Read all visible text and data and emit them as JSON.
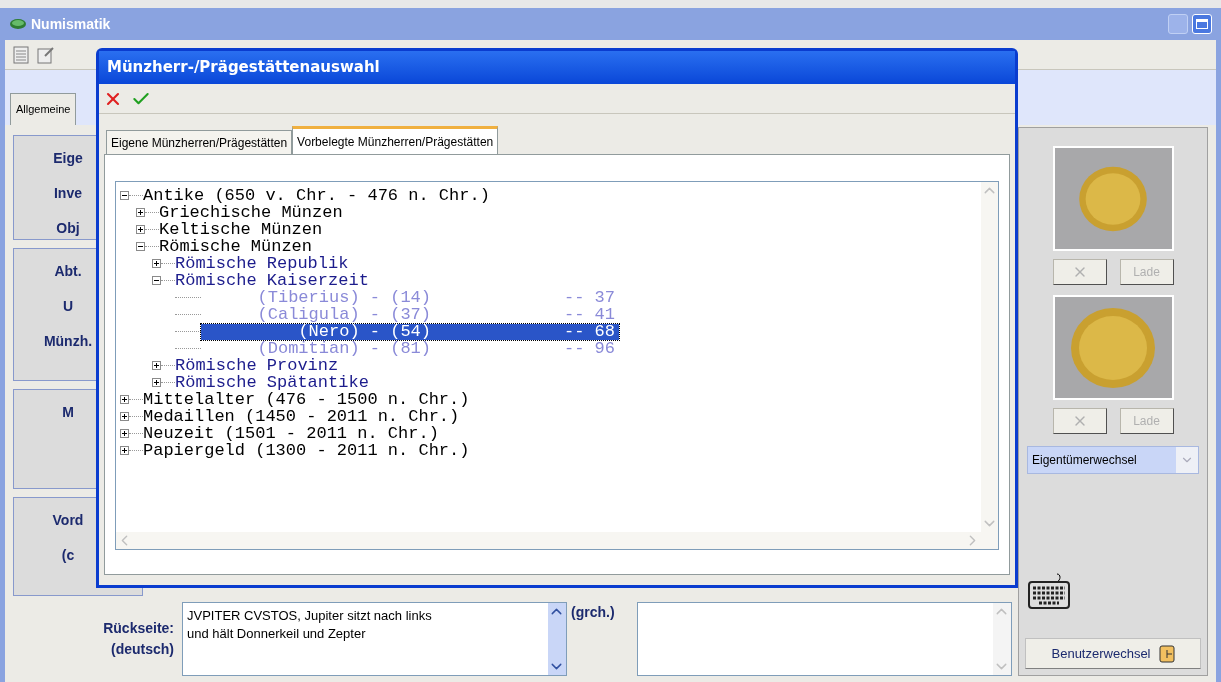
{
  "main_window": {
    "title": "Numismatik",
    "tab": "Allgemeine",
    "label_groups": [
      {
        "labels": [
          "Eige",
          "Inve",
          "Obj"
        ]
      },
      {
        "labels": [
          "Abt.",
          "U",
          "Münzh."
        ]
      },
      {
        "labels": [
          "M"
        ]
      },
      {
        "labels": [
          "Vord",
          "(c"
        ]
      }
    ],
    "images": [
      {
        "remove_disabled": true,
        "load_label": "Lade",
        "load_disabled": true
      },
      {
        "remove_disabled": true,
        "load_label": "Lade",
        "load_disabled": true
      }
    ],
    "owner_select": {
      "value": "Eigentümerwechsel"
    },
    "user_button": "Benutzerwechsel",
    "reverse": {
      "label": "Rückseite:",
      "sublabel": "(deutsch)",
      "lines": [
        "JVPITER CVSTOS, Jupiter sitzt nach links",
        "und hält Donnerkeil und Zepter"
      ],
      "greek_label": "(grch.)"
    }
  },
  "dialog": {
    "title": "Münzherr-/Prägestättenauswahl",
    "tabs": [
      {
        "label": "Eigene Münzherren/Prägestätten",
        "selected": false
      },
      {
        "label": "Vorbelegte Münzherren/Prägestätten",
        "selected": true
      }
    ],
    "tree": [
      {
        "label": "Antike (650 v. Chr. - 476 n. Chr.)",
        "expanded": true,
        "children": [
          {
            "label": "Griechische Münzen",
            "expanded": false
          },
          {
            "label": "Keltische Münzen",
            "expanded": false
          },
          {
            "label": "Römische Münzen",
            "expanded": true,
            "children": [
              {
                "label": "Römische Republik",
                "expanded": false
              },
              {
                "label": "Römische Kaiserzeit",
                "expanded": true,
                "children": [
                  {
                    "label": "(Tiberius) - (14)",
                    "value": "-- 37",
                    "selected": false
                  },
                  {
                    "label": "(Caligula) - (37)",
                    "value": "-- 41",
                    "selected": false
                  },
                  {
                    "label": "(Nero) - (54)",
                    "value": "-- 68",
                    "selected": true
                  },
                  {
                    "label": "(Domitian) - (81)",
                    "value": "-- 96",
                    "selected": false
                  }
                ]
              },
              {
                "label": "Römische Provinz",
                "expanded": false
              },
              {
                "label": "Römische Spätantike",
                "expanded": false
              }
            ]
          }
        ]
      },
      {
        "label": "Mittelalter (476 - 1500 n. Chr.)",
        "expanded": false
      },
      {
        "label": "Medaillen (1450 - 2011 n. Chr.)",
        "expanded": false
      },
      {
        "label": "Neuzeit (1501 - 2011 n. Chr.)",
        "expanded": false
      },
      {
        "label": "Papiergeld (1300 - 2011 n. Chr.)",
        "expanded": false
      }
    ]
  }
}
